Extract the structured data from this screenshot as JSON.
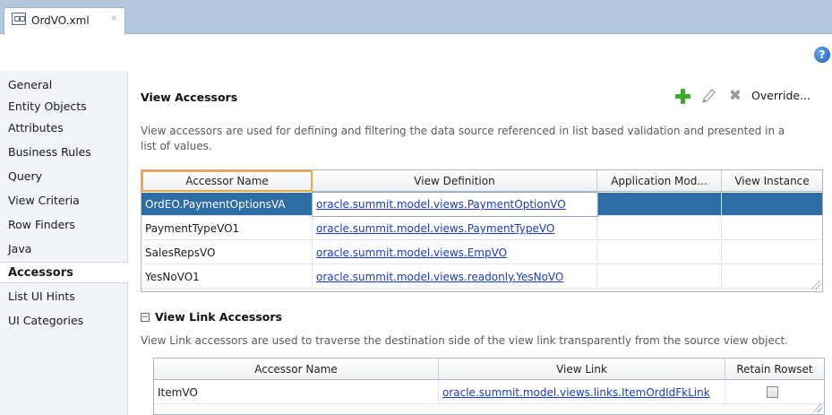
{
  "tab": {
    "label": "OrdVO.xml",
    "close": "×"
  },
  "help": {
    "glyph": "?"
  },
  "nav": {
    "items": [
      "General",
      "Entity Objects",
      "Attributes",
      "Business Rules",
      "Query",
      "View Criteria",
      "Row Finders",
      "Java",
      "Accessors",
      "List UI Hints",
      "UI Categories"
    ],
    "selected": "Accessors"
  },
  "view_accessors": {
    "title": "View Accessors",
    "description_line1": "View accessors are used for defining and filtering the data source referenced in list based validation and presented in a",
    "description_line2": "list of values.",
    "actions": {
      "add_icon": "plus-icon",
      "edit_icon": "pencil-icon",
      "delete_icon": "x-icon",
      "override_label": "Override..."
    },
    "columns": [
      "Accessor Name",
      "View Definition",
      "Application Mod...",
      "View Instance"
    ],
    "rows": [
      {
        "name": "OrdEO.PaymentOptionsVA",
        "definition": "oracle.summit.model.views.PaymentOptionVO",
        "app_module": "",
        "instance": ""
      },
      {
        "name": "PaymentTypeVO1",
        "definition": "oracle.summit.model.views.PaymentTypeVO",
        "app_module": "",
        "instance": ""
      },
      {
        "name": "SalesRepsVO",
        "definition": "oracle.summit.model.views.EmpVO",
        "app_module": "",
        "instance": ""
      },
      {
        "name": "YesNoVO1",
        "definition": "oracle.summit.model.views.readonly.YesNoVO",
        "app_module": "",
        "instance": ""
      }
    ]
  },
  "view_link_accessors": {
    "toggle": "−",
    "title": "View Link Accessors",
    "description": "View Link accessors are used to traverse the destination side of the view link transparently from the source view object.",
    "columns": [
      "Accessor Name",
      "View Link",
      "Retain Rowset"
    ],
    "rows": [
      {
        "name": "ItemVO",
        "link": "oracle.summit.model.views.links.ItemOrdIdFkLink",
        "retain_rowset": false
      }
    ]
  },
  "colors": {
    "selection": "#2e6ca6",
    "link": "#1a3cc4",
    "tab_strip": "#b4c8e0",
    "add_green": "#3cab2e",
    "focus_orange": "#f0a64a"
  }
}
